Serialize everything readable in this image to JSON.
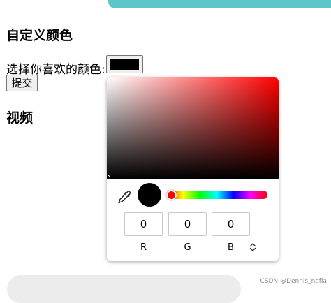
{
  "section1": {
    "heading": "自定义颜色"
  },
  "form": {
    "prompt_label": "选择你喜欢的颜色:",
    "color_value": "#000000",
    "submit_label": "提交"
  },
  "section2": {
    "heading": "视频"
  },
  "picker": {
    "hue_color": "#ff0000",
    "channels": [
      {
        "value": "0",
        "label": "R"
      },
      {
        "value": "0",
        "label": "G"
      },
      {
        "value": "0",
        "label": "B"
      }
    ],
    "eyedropper_icon": "eyedropper-icon",
    "mode_toggle_icon": "up-down-chevron-icon"
  },
  "watermark": "CSDN @Dennis_nafla",
  "colors": {
    "accent_bar": "#5cc6c8"
  }
}
